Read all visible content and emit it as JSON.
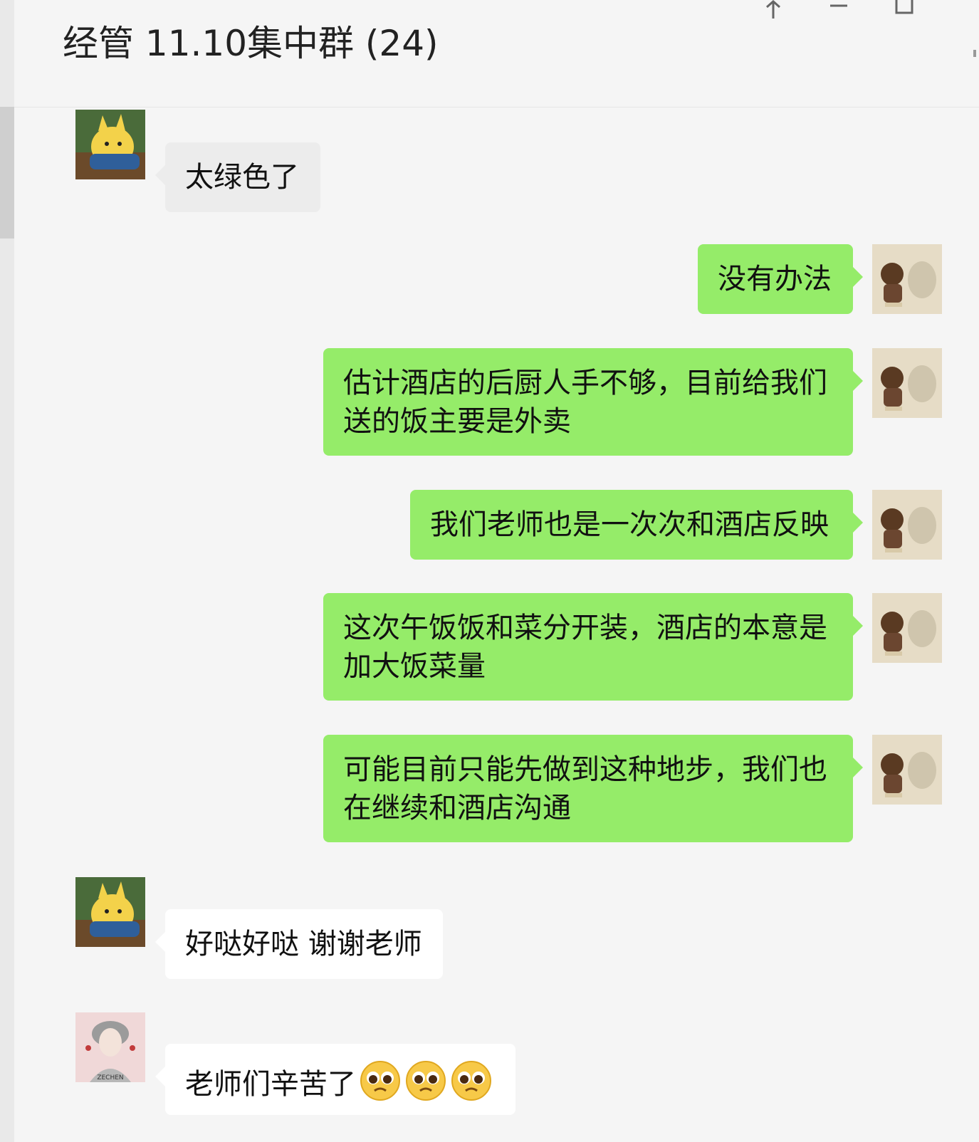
{
  "window": {
    "title": "经管 11.10集中群 (24)",
    "controls": [
      "pin-icon",
      "minimize-icon",
      "maximize-icon"
    ]
  },
  "messages": [
    {
      "direction": "incoming",
      "avatar": "cartoon-chick-avatar-icon",
      "text": "太绿色了"
    },
    {
      "direction": "outgoing",
      "avatar": "figurine-avatar-icon",
      "text": "没有办法"
    },
    {
      "direction": "outgoing",
      "avatar": "figurine-avatar-icon",
      "text": "估计酒店的后厨人手不够，目前给我们送的饭主要是外卖"
    },
    {
      "direction": "outgoing",
      "avatar": "figurine-avatar-icon",
      "text": "我们老师也是一次次和酒店反映"
    },
    {
      "direction": "outgoing",
      "avatar": "figurine-avatar-icon",
      "text": "这次午饭饭和菜分开装，酒店的本意是加大饭菜量"
    },
    {
      "direction": "outgoing",
      "avatar": "figurine-avatar-icon",
      "text": "可能目前只能先做到这种地步，我们也在继续和酒店沟通"
    },
    {
      "direction": "incoming",
      "avatar": "cartoon-chick-avatar-icon",
      "text": "好哒好哒 谢谢老师"
    },
    {
      "direction": "incoming",
      "avatar": "girl-portrait-avatar-icon",
      "avatar_caption": "ZECHEN",
      "text": "老师们辛苦了",
      "emojis": [
        "pleading-face-emoji-icon",
        "pleading-face-emoji-icon",
        "pleading-face-emoji-icon"
      ]
    }
  ],
  "colors": {
    "background": "#f5f5f5",
    "outgoing_bubble": "#95ec69",
    "incoming_bubble": "#ffffff",
    "incoming_bubble_first": "#ececec"
  }
}
